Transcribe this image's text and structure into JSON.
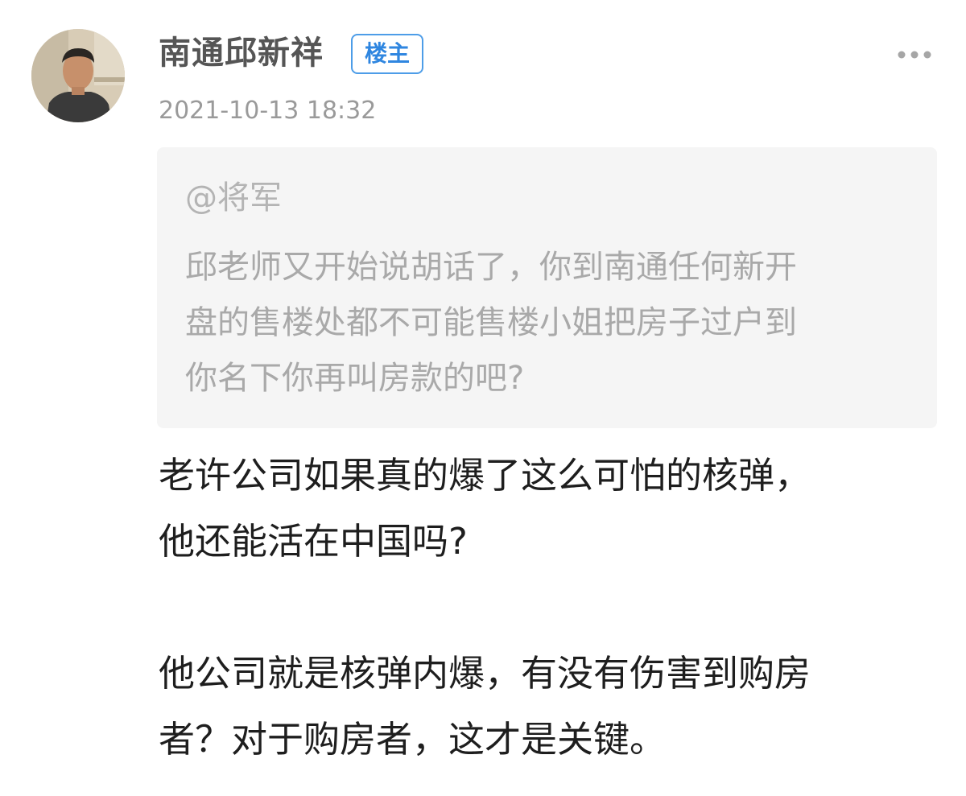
{
  "post": {
    "author": {
      "name": "南通邱新祥",
      "badge": "楼主",
      "avatar_icon": "user-photo-avatar"
    },
    "timestamp": "2021-10-13 18:32",
    "more_icon": "more-dots-icon",
    "quote": {
      "mention": "@将军",
      "lines": [
        "邱老师又开始说胡话了，你到南通任何新开",
        "盘的售楼处都不可能售楼小姐把房子过户到",
        "你名下你再叫房款的吧?"
      ]
    },
    "content": {
      "paragraph_1": [
        "老许公司如果真的爆了这么可怕的核弹，",
        "他还能活在中国吗?"
      ],
      "paragraph_2": [
        "他公司就是核弹内爆，有没有伤害到购房",
        "者？对于购房者，这才是关键。"
      ]
    }
  },
  "colors": {
    "author_name": "#555555",
    "badge_accent": "#2f86e0",
    "timestamp": "#9a9a9a",
    "quote_background": "#f5f5f5",
    "quote_text": "#a9a9a9",
    "body_text": "#1e1e1e"
  }
}
